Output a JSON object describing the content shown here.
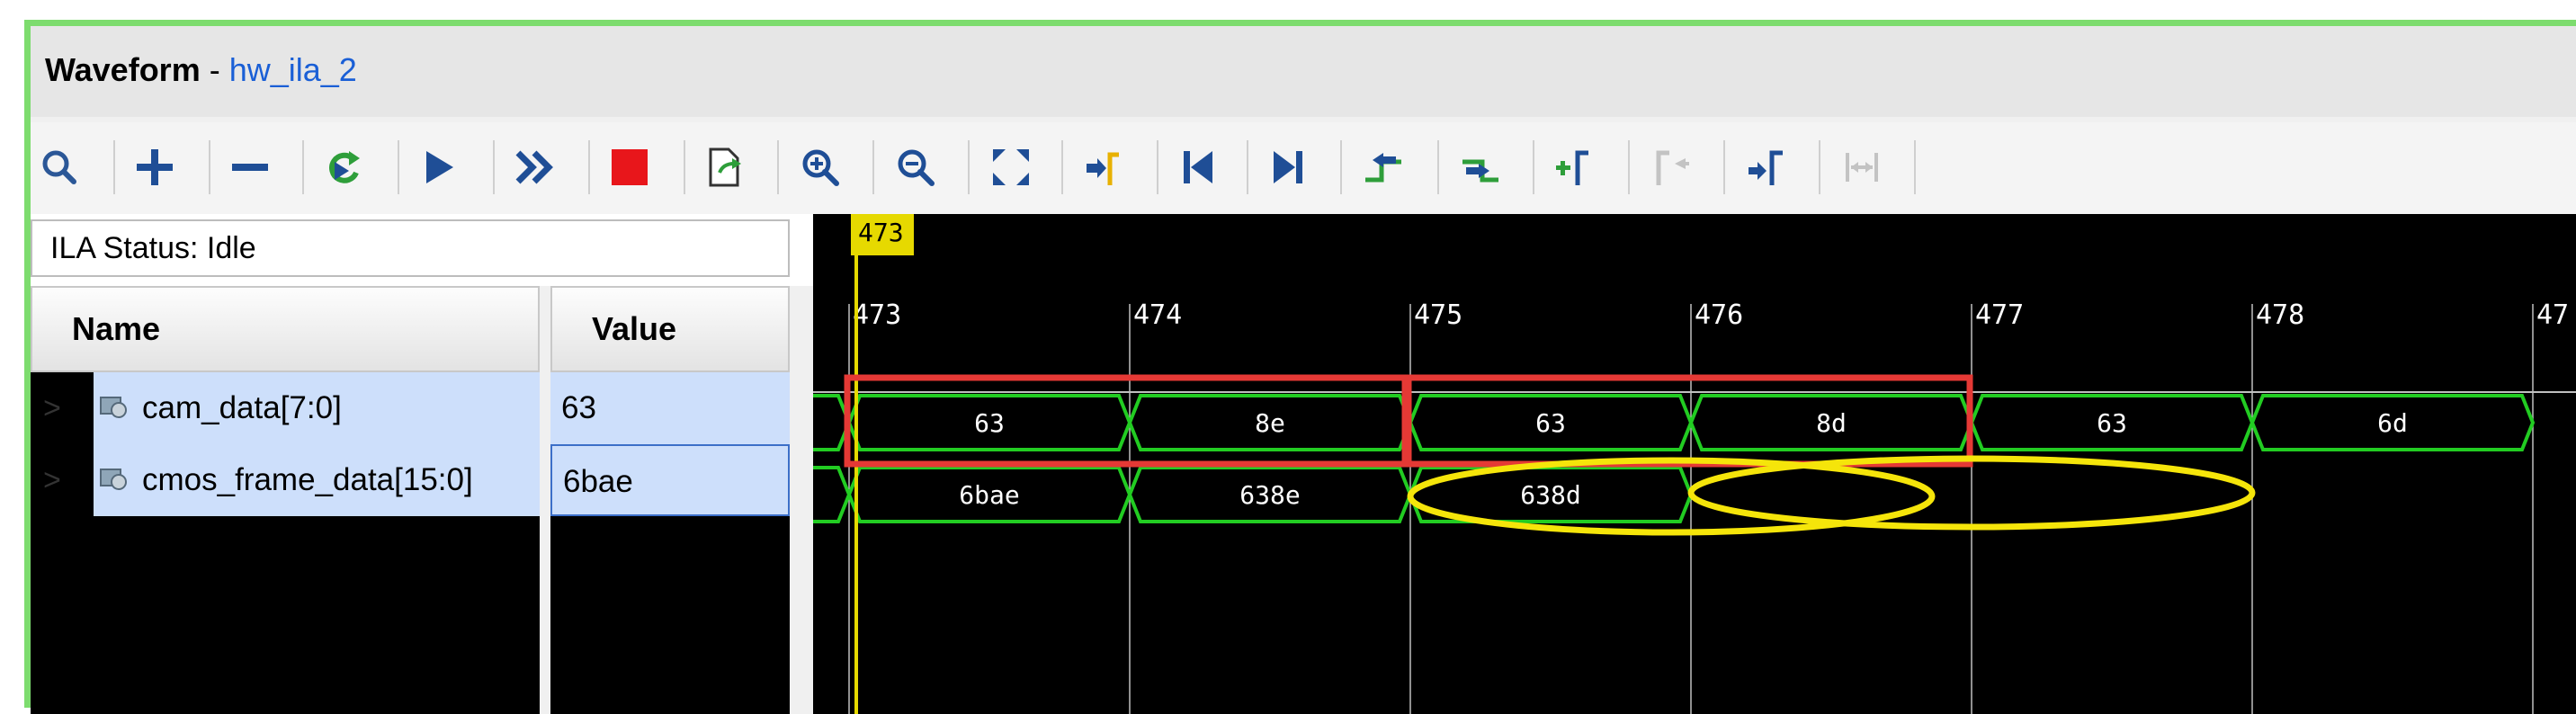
{
  "window": {
    "title_bold": "Waveform",
    "title_sep": " - ",
    "title_name": "hw_ila_2"
  },
  "toolbar": {
    "buttons": [
      {
        "name": "search-icon",
        "enabled": true
      },
      {
        "name": "add-icon",
        "enabled": true
      },
      {
        "name": "remove-icon",
        "enabled": true
      },
      {
        "name": "run-trigger-immediate-icon",
        "enabled": true
      },
      {
        "name": "run-trigger-icon",
        "enabled": true
      },
      {
        "name": "auto-retrigger-icon",
        "enabled": true
      },
      {
        "name": "stop-icon",
        "enabled": true
      },
      {
        "name": "export-icon",
        "enabled": true
      },
      {
        "name": "zoom-in-icon",
        "enabled": true
      },
      {
        "name": "zoom-out-icon",
        "enabled": true
      },
      {
        "name": "zoom-fit-icon",
        "enabled": true
      },
      {
        "name": "go-to-cursor-icon",
        "enabled": true
      },
      {
        "name": "go-to-time-zero-icon",
        "enabled": true
      },
      {
        "name": "go-to-last-time-icon",
        "enabled": true
      },
      {
        "name": "previous-transition-icon",
        "enabled": true
      },
      {
        "name": "next-transition-icon",
        "enabled": true
      },
      {
        "name": "add-marker-icon",
        "enabled": true
      },
      {
        "name": "previous-marker-icon",
        "enabled": false
      },
      {
        "name": "next-marker-icon",
        "enabled": true
      },
      {
        "name": "swap-cursors-icon",
        "enabled": false
      }
    ]
  },
  "status": {
    "text": "ILA Status:  Idle"
  },
  "columns": {
    "name": "Name",
    "value": "Value"
  },
  "signals": [
    {
      "name": "cam_data[7:0]",
      "value": "63"
    },
    {
      "name": "cmos_frame_data[15:0]",
      "value": "6bae"
    }
  ],
  "waveform": {
    "cursor_label": "473",
    "ticks": [
      "473",
      "474",
      "475",
      "476",
      "477",
      "478",
      "47"
    ],
    "cam_data_segments": [
      "63",
      "8e",
      "63",
      "8d",
      "63",
      "6d"
    ],
    "frame_data_segments": [
      "6bae",
      "638e",
      "638d"
    ],
    "colors": {
      "wave": "#22cc22",
      "grid": "#bfbfbf",
      "cursor": "#e6d900",
      "highlight_box": "#e53935",
      "highlight_ellipse": "#f5e50a",
      "text": "#ffffff"
    }
  }
}
